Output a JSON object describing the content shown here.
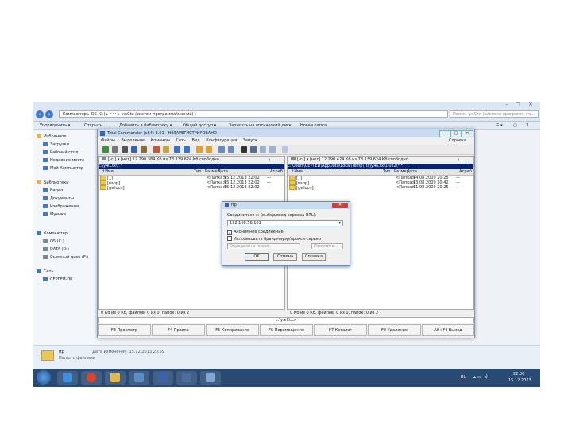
{
  "explorer": {
    "window_buttons": [
      "–",
      "□",
      "✕"
    ],
    "breadcrumb": "Компьютер ▸ OS (C:) ▸ ••• ▸ ужCtx (систем программа/знаний) ▸",
    "search_placeholder": "Поиск: ужСтх (система программ) по...",
    "toolbar": {
      "organize": "Упорядочить ▾",
      "open": "Открыть",
      "add_library": "Добавить в библиотеку ▾",
      "share": "Общий доступ ▾",
      "burn": "Записать на оптический диск",
      "new_folder": "Новая папка"
    },
    "sidebar": [
      {
        "label": "Избранное",
        "icon": "star-icon",
        "color": "#e8b923"
      },
      {
        "label": "Загрузки",
        "icon": "download-folder-icon",
        "color": "#3d7bc7"
      },
      {
        "label": "Рабочий стол",
        "icon": "desktop-icon",
        "color": "#3d7bc7"
      },
      {
        "label": "Недавние места",
        "icon": "recent-icon",
        "color": "#3d7bc7"
      },
      {
        "label": "Мой Компьютер",
        "icon": "computer-icon",
        "color": "#3d7bc7"
      },
      {
        "label": "Библиотеки",
        "icon": "library-icon",
        "color": "#e0b447"
      },
      {
        "label": "Видео",
        "icon": "video-icon",
        "color": "#3d7bc7"
      },
      {
        "label": "Документы",
        "icon": "documents-icon",
        "color": "#3d7bc7"
      },
      {
        "label": "Изображения",
        "icon": "pictures-icon",
        "color": "#3d7bc7"
      },
      {
        "label": "Музыка",
        "icon": "music-icon",
        "color": "#3d7bc7"
      },
      {
        "label": "Компьютер",
        "icon": "computer-icon",
        "color": "#3d7bc7"
      },
      {
        "label": "OS (C:)",
        "icon": "drive-icon",
        "color": "#7a8898"
      },
      {
        "label": "DATA (D:)",
        "icon": "drive-icon",
        "color": "#7a8898"
      },
      {
        "label": "Съемный диск (F:)",
        "icon": "removable-drive-icon",
        "color": "#7a8898"
      },
      {
        "label": "Сеть",
        "icon": "network-icon",
        "color": "#3d7bc7"
      },
      {
        "label": "СЕРГЕЙ-ПК",
        "icon": "pc-icon",
        "color": "#3d7bc7"
      }
    ],
    "details": {
      "name": "ftp",
      "type": "Папка с файлами",
      "date_label": "Дата изменения: 15.12.2013 23:59"
    },
    "taskbar": {
      "apps": [
        {
          "icon": "ie-icon",
          "color": "#3f8fde"
        },
        {
          "icon": "chrome-icon",
          "color": "#d9452b"
        },
        {
          "icon": "explorer-icon",
          "color": "#e3b84c"
        },
        {
          "icon": "media-icon",
          "color": "#5b8ec7"
        },
        {
          "icon": "total-commander-icon",
          "color": "#3c63a8"
        },
        {
          "icon": "app-icon",
          "color": "#4c6e9e"
        },
        {
          "icon": "paint-icon",
          "color": "#7fa7d6"
        }
      ],
      "lang": "RU",
      "time": "22:00",
      "date": "15.12.2013"
    }
  },
  "tc": {
    "title": "Total Commander (x64) 8.01 - НЕЗАРЕГИСТРИРОВАНО",
    "menu": [
      "Файлы",
      "Выделение",
      "Команды",
      "Сеть",
      "Вид",
      "Конфигурация",
      "Запуск"
    ],
    "help": "Справка",
    "left": {
      "drive": "[-c-] ▾  [нет]  12 290 384 Кб из 78 139 624 Кб свободно",
      "path": "c:\\ужCtx\\*.*",
      "col_name": "↑Имя",
      "col_ext": "Тип",
      "col_size": "Размер",
      "col_date": "Дата",
      "col_attr": "Атриб",
      "rows": [
        {
          "name": "[..]",
          "size": "<Папка>",
          "date": "15.12.2013 22:02",
          "attr": "—"
        },
        {
          "name": "[вэпр]",
          "size": "<Папка>",
          "date": "15.12.2013 22:02",
          "attr": "—"
        },
        {
          "name": "[gwlocn]",
          "size": "<Папка>",
          "date": "15.12.2013 22:02",
          "attr": "—"
        }
      ],
      "status": "0 Кб из 0 Кб, файлов: 0 из 0, папок: 0 из 2"
    },
    "right": {
      "drive": "[-c-] ▾  [нет]  12 290 424 Кб из 78 139 624 Кб свободно",
      "path": "c:\\Users\\СЕРГЕЙ\\AppData\\Local\\Temp\\_tc\\ужCtx\\1.0x2\\*.*",
      "col_name": "↑Имя",
      "col_ext": "Тип",
      "col_size": "Размер",
      "col_date": "Дата",
      "col_attr": "Атриб",
      "rows": [
        {
          "name": "[..]",
          "size": "<Папка>",
          "date": "14.08.2009 20:25",
          "attr": "—"
        },
        {
          "name": "[вэпр]",
          "size": "<Папка>",
          "date": "13.08.2009 10:42",
          "attr": "—"
        },
        {
          "name": "[gwlocn]",
          "size": "<Папка>",
          "date": "11.08.2009 20:25",
          "attr": "—"
        }
      ],
      "status": "0 Кб из 0 Кб, файлов: 0 из 0, папок: 0 из 2"
    },
    "cmdline": "c:\\ужCtx>",
    "fkeys": [
      "F3 Просмотр",
      "F4 Правка",
      "F5 Копирование",
      "F6 Перемещение",
      "F7 Каталог",
      "F8 Удаление",
      "Alt+F4 Выход"
    ]
  },
  "ftp_dialog": {
    "title": "ftp",
    "close": "✕",
    "label": "Соединиться с: (выбор/ввод сервера URL):",
    "input": "192.168.56.101",
    "check1": "Анонимное соединение",
    "check2": "Использовать брандмауэр/прокси-сервер",
    "select_placeholder": "Определить новое...",
    "select_btn": "Изменить...",
    "ok": "OK",
    "cancel": "Отмена",
    "help": "Справка"
  }
}
